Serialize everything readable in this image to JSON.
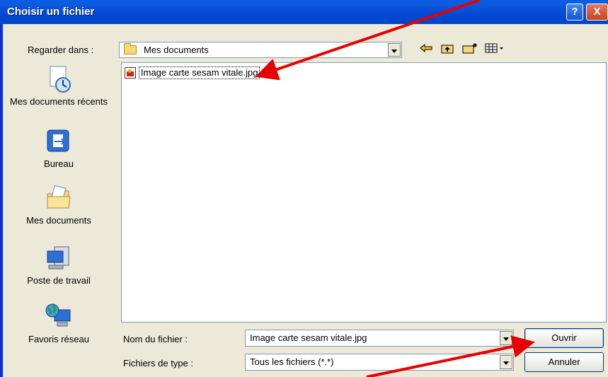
{
  "window": {
    "title": "Choisir un fichier",
    "help_label": "?",
    "close_label": "X"
  },
  "lookin": {
    "label": "Regarder dans :",
    "value": "Mes documents"
  },
  "toolbar": {
    "back_icon": "back-arrow-icon",
    "up_icon": "up-folder-icon",
    "new_folder_icon": "new-folder-icon",
    "views_icon": "views-menu-icon"
  },
  "places": [
    {
      "label": "Mes documents récents",
      "icon": "recent-documents-icon"
    },
    {
      "label": "Bureau",
      "icon": "desktop-icon"
    },
    {
      "label": "Mes documents",
      "icon": "my-documents-icon"
    },
    {
      "label": "Poste de travail",
      "icon": "my-computer-icon"
    },
    {
      "label": "Favoris réseau",
      "icon": "network-places-icon"
    }
  ],
  "files": [
    {
      "name": "Image carte sesam vitale.jpg",
      "icon": "jpg-image-icon"
    }
  ],
  "filename": {
    "label": "Nom du fichier :",
    "value": "Image carte sesam vitale.jpg"
  },
  "filetype": {
    "label": "Fichiers de type :",
    "value": "Tous les fichiers (*.*)"
  },
  "buttons": {
    "open": "Ouvrir",
    "cancel": "Annuler"
  },
  "colors": {
    "titlebar": "#0349d1",
    "annotation_arrow": "#e60000",
    "dialog_bg": "#ece9d8"
  }
}
